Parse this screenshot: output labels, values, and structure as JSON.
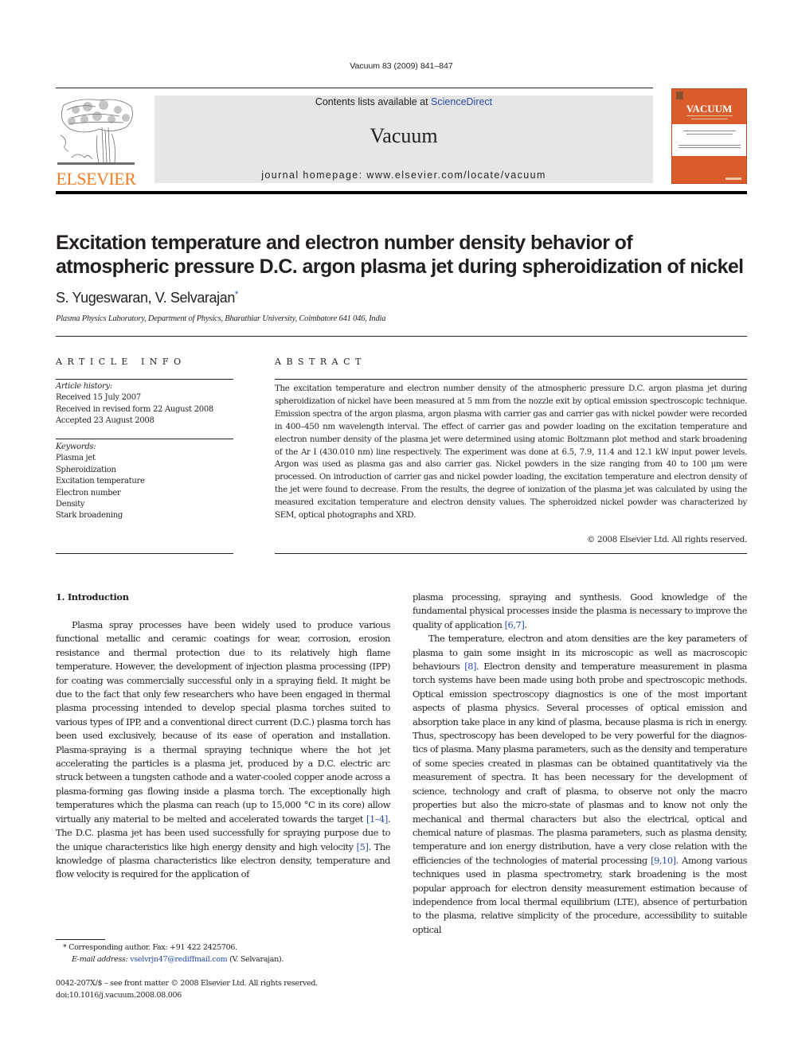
{
  "header": {
    "citation": "Vacuum 83 (2009) 841–847",
    "contents_prefix": "Contents lists available at ",
    "contents_link": "ScienceDirect",
    "journal_name": "Vacuum",
    "homepage": "journal homepage: www.elsevier.com/locate/vacuum",
    "publisher_logo_text": "ELSEVIER",
    "cover_title": "VACUUM"
  },
  "colors": {
    "link_blue": "#2a4bb1",
    "elsevier_orange": "#f47f24",
    "cover_orange": "#d95c2a",
    "masthead_gray": "#e6e6e6"
  },
  "article": {
    "title": "Excitation temperature and electron number density behavior of atmospheric pressure D.C. argon plasma jet during spheroidization of nickel",
    "authors": "S. Yugeswaran, V. Selvarajan",
    "corresponding_marker": "*",
    "affiliation": "Plasma Physics Laboratory, Department of Physics, Bharathiar University, Coimbatore 641 046, India"
  },
  "article_info": {
    "heading": "ARTICLE INFO",
    "history_label": "Article history:",
    "history": [
      "Received 15 July 2007",
      "Received in revised form 22 August 2008",
      "Accepted 23 August 2008"
    ],
    "keywords_label": "Keywords:",
    "keywords": [
      "Plasma jet",
      "Spheroidization",
      "Excitation temperature",
      "Electron number",
      "Density",
      "Stark broadening"
    ]
  },
  "abstract": {
    "heading": "ABSTRACT",
    "text": "The excitation temperature and electron number density of the atmospheric pressure D.C. argon plasma jet during spheroidization of nickel have been measured at 5 mm from the nozzle exit by optical emission spectroscopic technique. Emission spectra of the argon plasma, argon plasma with carrier gas and carrier gas with nickel powder were recorded in 400–450 nm wavelength interval. The effect of carrier gas and powder loading on the excitation temperature and electron number density of the plasma jet were determined using atomic Boltzmann plot method and stark broadening of the Ar I (430.010 nm) line respectively. The experiment was done at 6.5, 7.9, 11.4 and 12.1 kW input power levels. Argon was used as plasma gas and also carrier gas. Nickel powders in the size ranging from 40 to 100 μm were processed. On introduction of carrier gas and nickel powder loading, the excitation temperature and electron density of the jet were found to decrease. From the results, the degree of ionization of the plasma jet was calculated by using the measured excitation temperature and electron density values. The spheroidzed nickel powder was characterized by SEM, optical photographs and XRD.",
    "copyright": "© 2008 Elsevier Ltd. All rights reserved."
  },
  "body": {
    "section_heading": "1.  Introduction",
    "left_p1_a": "Plasma spray processes have been widely used to produce various functional metallic and ceramic coatings for wear, corro­sion, erosion resistance and thermal protection due to its relatively high flame temperature. However, the development of injection plasma processing (IPP) for coating was commercially successful only in a spraying field. It might be due to the fact that only few researchers who have been engaged in thermal plasma processing intended to develop special plasma torches suited to various types of IPP, and a conventional direct current (D.C.) plasma torch has been used exclusively, because of its ease of operation and instal­lation. Plasma-spraying is a thermal spraying technique where the hot jet accelerating the particles is a plasma jet, produced by a D.C. electric arc struck between a tungsten cathode and a water-cooled copper anode across a plasma-forming gas flowing inside a plasma torch. The exceptionally high temperatures which the plasma can reach (up to 15,000 °C in its core) allow virtually any material to be melted and accelerated towards the target ",
    "ref_1_4": "[1–4]",
    "left_p1_b": ". The D.C. plasma jet has been used successfully for spraying purpose due to the unique characteristics like high energy density and high velocity ",
    "ref_5": "[5]",
    "left_p1_c": ". The knowledge of plasma characteristics like electron density, temperature and flow velocity is required for the application of",
    "right_p1_a": "plasma processing, spraying and synthesis. Good knowledge of the fundamental physical processes inside the plasma is necessary to improve the quality of application ",
    "ref_6_7": "[6,7]",
    "right_p1_b": ".",
    "right_p2_a": "The temperature, electron and atom densities are the key parameters of plasma to gain some insight in its microscopic as well as macroscopic behaviours ",
    "ref_8": "[8]",
    "right_p2_b": ". Electron density and temperature measurement in plasma torch systems have been made using both probe and spectroscopic methods. Optical emission spectroscopy diagnostics is one of the most important aspects of plasma physics. Several processes of optical emission and absorption take place in any kind of plasma, because plasma is rich in energy. Thus, spec­troscopy has been developed to be very powerful for the diagnos­tics of plasma. Many plasma parameters, such as the density and temperature of some species created in plasmas can be obtained quantitatively via the measurement of spectra. It has been neces­sary for the development of science, technology and craft of plasma, to observe not only the macro properties but also the micro-state of plasmas and to know not only the mechanical and thermal char­acters but also the electrical, optical and chemical nature of plasmas. The plasma parameters, such as plasma density, temper­ature and ion energy distribution, have a very close relation with the efficiencies of the technologies of material processing ",
    "ref_9_10": "[9,10]",
    "right_p2_c": ". Among various techniques used in plasma spectrometry, stark broadening is the most popular approach for electron density measurement estimation because of independence from local thermal equilibrium (LTE), absence of perturbation to the plasma, relative simplicity of the procedure, accessibility to suitable optical"
  },
  "footnotes": {
    "corresponding": "* Corresponding author. Fax: +91 422 2425706.",
    "email_label": "E-mail address:",
    "email": "vselvrjn47@rediffmail.com",
    "email_owner": " (V. Selvarajan).",
    "front_matter": "0042-207X/$ – see front matter © 2008 Elsevier Ltd. All rights reserved.",
    "doi": "doi:10.1016/j.vacuum.2008.08.006"
  }
}
